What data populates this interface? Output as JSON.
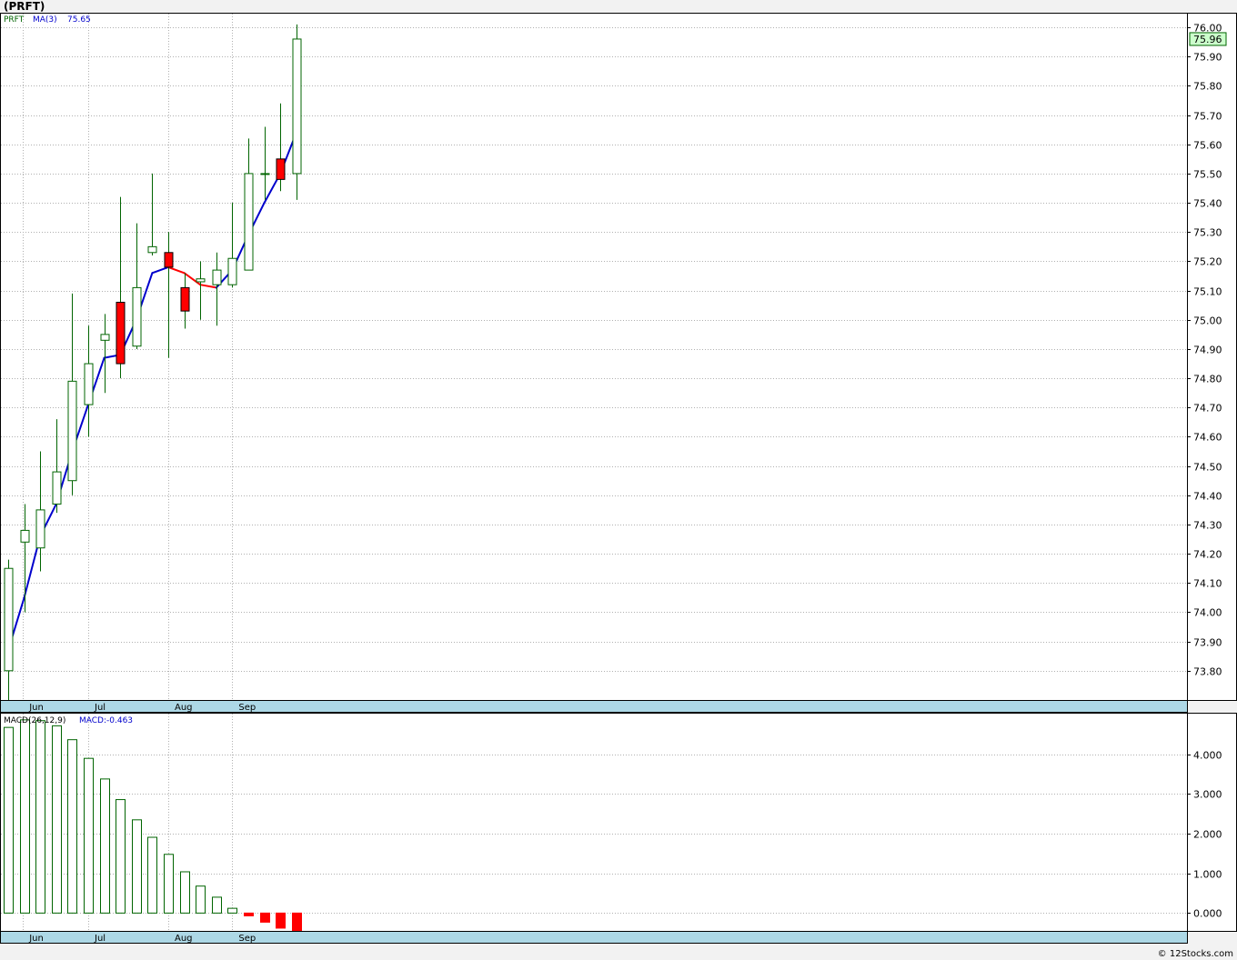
{
  "title": "(PRFT)",
  "footer": "© 12Stocks.com",
  "colors": {
    "up": "#006400",
    "down": "#ff0000",
    "ma": "#0000cc",
    "axis_band": "#add8e6",
    "price_tag": "#ccffcc"
  },
  "chart_data": [
    {
      "type": "candlestick",
      "legend": {
        "symbol": "PRFT",
        "ma_label": "MA(3)",
        "ma_value": "75.65"
      },
      "last_price_label": "75.96",
      "ylim": [
        73.7,
        76.05
      ],
      "yticks": [
        73.8,
        73.9,
        74.0,
        74.1,
        74.2,
        74.3,
        74.4,
        74.5,
        74.6,
        74.7,
        74.8,
        74.9,
        75.0,
        75.1,
        75.2,
        75.3,
        75.4,
        75.5,
        75.6,
        75.7,
        75.8,
        75.9,
        76.0
      ],
      "xlim": [
        0,
        18
      ],
      "month_ticks": [
        {
          "label": "Jun",
          "x": 0.92
        },
        {
          "label": "Jul",
          "x": 5.0
        },
        {
          "label": "Aug",
          "x": 10.0
        },
        {
          "label": "Sep",
          "x": 14.0
        }
      ],
      "candles": [
        {
          "o": 73.8,
          "h": 74.18,
          "l": 73.7,
          "c": 74.15
        },
        {
          "o": 74.24,
          "h": 74.37,
          "l": 74.0,
          "c": 74.28
        },
        {
          "o": 74.22,
          "h": 74.55,
          "l": 74.14,
          "c": 74.35
        },
        {
          "o": 74.37,
          "h": 74.66,
          "l": 74.34,
          "c": 74.48
        },
        {
          "o": 74.45,
          "h": 75.09,
          "l": 74.4,
          "c": 74.79
        },
        {
          "o": 74.71,
          "h": 74.98,
          "l": 74.6,
          "c": 74.85
        },
        {
          "o": 74.93,
          "h": 75.02,
          "l": 74.75,
          "c": 74.95
        },
        {
          "o": 75.06,
          "h": 75.42,
          "l": 74.8,
          "c": 74.85
        },
        {
          "o": 74.91,
          "h": 75.33,
          "l": 74.9,
          "c": 75.11
        },
        {
          "o": 75.23,
          "h": 75.5,
          "l": 75.22,
          "c": 75.25
        },
        {
          "o": 75.23,
          "h": 75.3,
          "l": 74.87,
          "c": 75.18
        },
        {
          "o": 75.11,
          "h": 75.16,
          "l": 74.97,
          "c": 75.03
        },
        {
          "o": 75.13,
          "h": 75.2,
          "l": 75.0,
          "c": 75.14
        },
        {
          "o": 75.12,
          "h": 75.23,
          "l": 74.98,
          "c": 75.17
        },
        {
          "o": 75.12,
          "h": 75.4,
          "l": 75.11,
          "c": 75.21
        },
        {
          "o": 75.17,
          "h": 75.62,
          "l": 75.17,
          "c": 75.5
        },
        {
          "o": 75.5,
          "h": 75.66,
          "l": 75.41,
          "c": 75.5
        },
        {
          "o": 75.55,
          "h": 75.74,
          "l": 75.44,
          "c": 75.48
        },
        {
          "o": 75.5,
          "h": 76.01,
          "l": 75.41,
          "c": 75.96
        }
      ],
      "ma3": [
        73.87,
        74.05,
        74.26,
        74.37,
        74.55,
        74.71,
        74.87,
        74.88,
        75.0,
        75.16,
        75.18,
        75.16,
        75.12,
        75.11,
        75.17,
        75.29,
        75.4,
        75.5,
        75.64
      ]
    },
    {
      "type": "bar",
      "legend": {
        "name": "MACD(26,12,9)",
        "value_label": "MACD:-0.463"
      },
      "ylim": [
        -0.45,
        5.05
      ],
      "yticks": [
        0.0,
        1.0,
        2.0,
        3.0,
        4.0
      ],
      "tick_labels": [
        "0.000",
        "1.000",
        "2.000",
        "3.000",
        "4.000"
      ],
      "xlim": [
        0,
        18
      ],
      "month_ticks": [
        {
          "label": "Jun",
          "x": 0.92
        },
        {
          "label": "Jul",
          "x": 5.0
        },
        {
          "label": "Aug",
          "x": 10.0
        },
        {
          "label": "Sep",
          "x": 14.0
        }
      ],
      "values": [
        4.68,
        4.87,
        4.85,
        4.72,
        4.37,
        3.9,
        3.38,
        2.86,
        2.35,
        1.91,
        1.48,
        1.04,
        0.68,
        0.4,
        0.12,
        -0.07,
        -0.23,
        -0.38,
        -0.46
      ]
    }
  ]
}
